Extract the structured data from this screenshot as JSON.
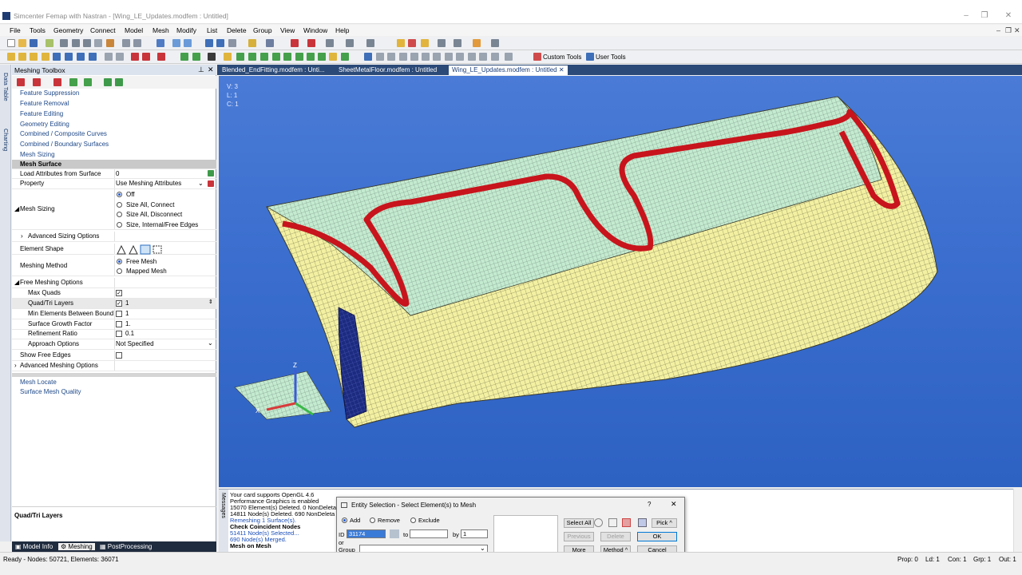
{
  "window": {
    "title": "Simcenter Femap with Nastran - [Wing_LE_Updates.modfem : Untitled]",
    "controls": [
      "–",
      "❐",
      "✕"
    ]
  },
  "menu": [
    "File",
    "Tools",
    "Geometry",
    "Connect",
    "Model",
    "Mesh",
    "Modify",
    "List",
    "Delete",
    "Group",
    "View",
    "Window",
    "Help"
  ],
  "toolbar2_labels": {
    "custom_tools": "Custom Tools",
    "user_tools": "User Tools"
  },
  "side_tabs": [
    "Data Table",
    "Charting"
  ],
  "toolbox": {
    "title": "Meshing Toolbox",
    "sections": [
      "Feature Suppression",
      "Feature Removal",
      "Feature Editing",
      "Geometry Editing",
      "Combined / Composite Curves",
      "Combined / Boundary Surfaces",
      "Mesh Sizing"
    ],
    "selected_section": "Mesh Surface",
    "rows": {
      "load_attributes": {
        "label": "Load Attributes from Surface",
        "value": "0"
      },
      "property": {
        "label": "Property",
        "value": "Use Meshing Attributes"
      },
      "mesh_sizing": {
        "label": "Mesh Sizing",
        "options": [
          "Off",
          "Size All, Connect",
          "Size All, Disconnect",
          "Size, Internal/Free Edges"
        ],
        "selected": "Off"
      },
      "advanced_sizing": {
        "label": "Advanced Sizing Options"
      },
      "element_shape": {
        "label": "Element Shape"
      },
      "meshing_method": {
        "label": "Meshing Method",
        "options": [
          "Free Mesh",
          "Mapped Mesh"
        ],
        "selected": "Free Mesh"
      },
      "free_meshing_options": {
        "label": "Free Meshing Options"
      },
      "max_quads": {
        "label": "Max Quads",
        "checked": true
      },
      "quad_tri_layers": {
        "label": "Quad/Tri Layers",
        "checked": true,
        "value": "1"
      },
      "min_elements": {
        "label": "Min Elements Between Bound",
        "checked": false,
        "value": "1"
      },
      "growth_factor": {
        "label": "Surface Growth Factor",
        "checked": false,
        "value": "1."
      },
      "refinement_ratio": {
        "label": "Refinement Ratio",
        "checked": false,
        "value": "0.1"
      },
      "approach_options": {
        "label": "Approach Options",
        "value": "Not Specified"
      },
      "show_free_edges": {
        "label": "Show Free Edges",
        "checked": false
      },
      "advanced_meshing": {
        "label": "Advanced Meshing Options"
      }
    },
    "after_sections": [
      "Mesh Locate",
      "Surface Mesh Quality"
    ],
    "help_title": "Quad/Tri Layers"
  },
  "bottom_tabs": [
    "Model Info",
    "Meshing",
    "PostProcessing"
  ],
  "doc_tabs": [
    "Blended_EndFitting.modfem : Unti...",
    "SheetMetalFloor.modfem : Untitled",
    "Wing_LE_Updates.modfem : Untitled"
  ],
  "viewport": {
    "info": [
      "V: 3",
      "L: 1",
      "C: 1"
    ],
    "axis": {
      "z": "Z",
      "x": "X"
    }
  },
  "messages": [
    "Your card supports OpenGL 4.6",
    "Performance Graphics is enabled",
    "15070 Element(s) Deleted. 0 NonDeleta",
    "14811 Node(s) Deleted. 690 NonDeleta",
    "Remeshing 1 Surface(s).",
    "Check Coincident Nodes",
    "51411 Node(s) Selected...",
    "690 Node(s) Merged.",
    "Mesh on Mesh"
  ],
  "messages_tab": "Messages",
  "dialog": {
    "title": "Entity Selection - Select Element(s) to Mesh",
    "help": "?",
    "modes": [
      "Add",
      "Remove",
      "Exclude"
    ],
    "mode_selected": "Add",
    "id_label": "ID",
    "id_value": "31174",
    "to_label": "to",
    "by_label": "by",
    "by_value": "1",
    "or_label": "or",
    "group_label": "Group",
    "buttons": {
      "select_all": "Select All",
      "pick": "Pick ^",
      "previous": "Previous",
      "delete": "Delete",
      "ok": "OK",
      "more": "More",
      "method": "Method ^",
      "cancel": "Cancel"
    }
  },
  "status": {
    "left": "Ready - Nodes: 50721, Elements: 36071",
    "prop": "Prop: 0",
    "ld": "Ld: 1",
    "con": "Con: 1",
    "grp": "Grp: 1",
    "out": "Out: 1"
  },
  "colors": {
    "accent": "#2b4a78",
    "mesh_yellow": "#f3f0a2",
    "mesh_green": "#bfe8c4",
    "red_band": "#c8141c",
    "viewport_blue": "#3c6fcf"
  }
}
